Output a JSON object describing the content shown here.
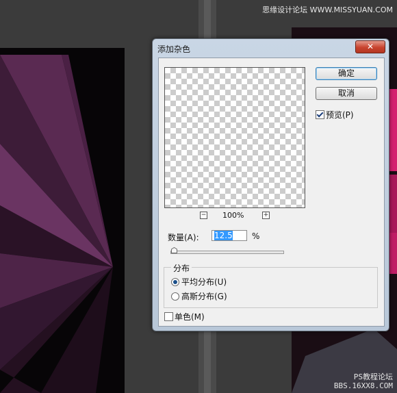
{
  "watermark": {
    "top": "思缘设计论坛 WWW.MISSYUAN.COM",
    "bottom_line1": "PS教程论坛",
    "bottom_line2": "BBS.16XX8.COM"
  },
  "dialog": {
    "title": "添加杂色",
    "close_glyph": "✕",
    "buttons": {
      "ok": "确定",
      "cancel": "取消"
    },
    "preview_checkbox": {
      "label": "预览(P)",
      "checked": true
    },
    "zoom": {
      "minus": "−",
      "plus": "+",
      "level": "100%"
    },
    "amount": {
      "label": "数量(A):",
      "value": "12.5",
      "unit": "%"
    },
    "slider": {
      "value": 12.5,
      "max": 400
    },
    "distribution": {
      "legend": "分布",
      "options": [
        {
          "label": "平均分布(U)",
          "selected": true
        },
        {
          "label": "高斯分布(G)",
          "selected": false
        }
      ]
    },
    "monochromatic": {
      "label": "单色(M)",
      "checked": false
    }
  },
  "colors": {
    "accent": "#3399ff",
    "close_red": "#c8432e",
    "artwork_purple": "#5a2a52",
    "artwork_pink": "#d4206f"
  }
}
